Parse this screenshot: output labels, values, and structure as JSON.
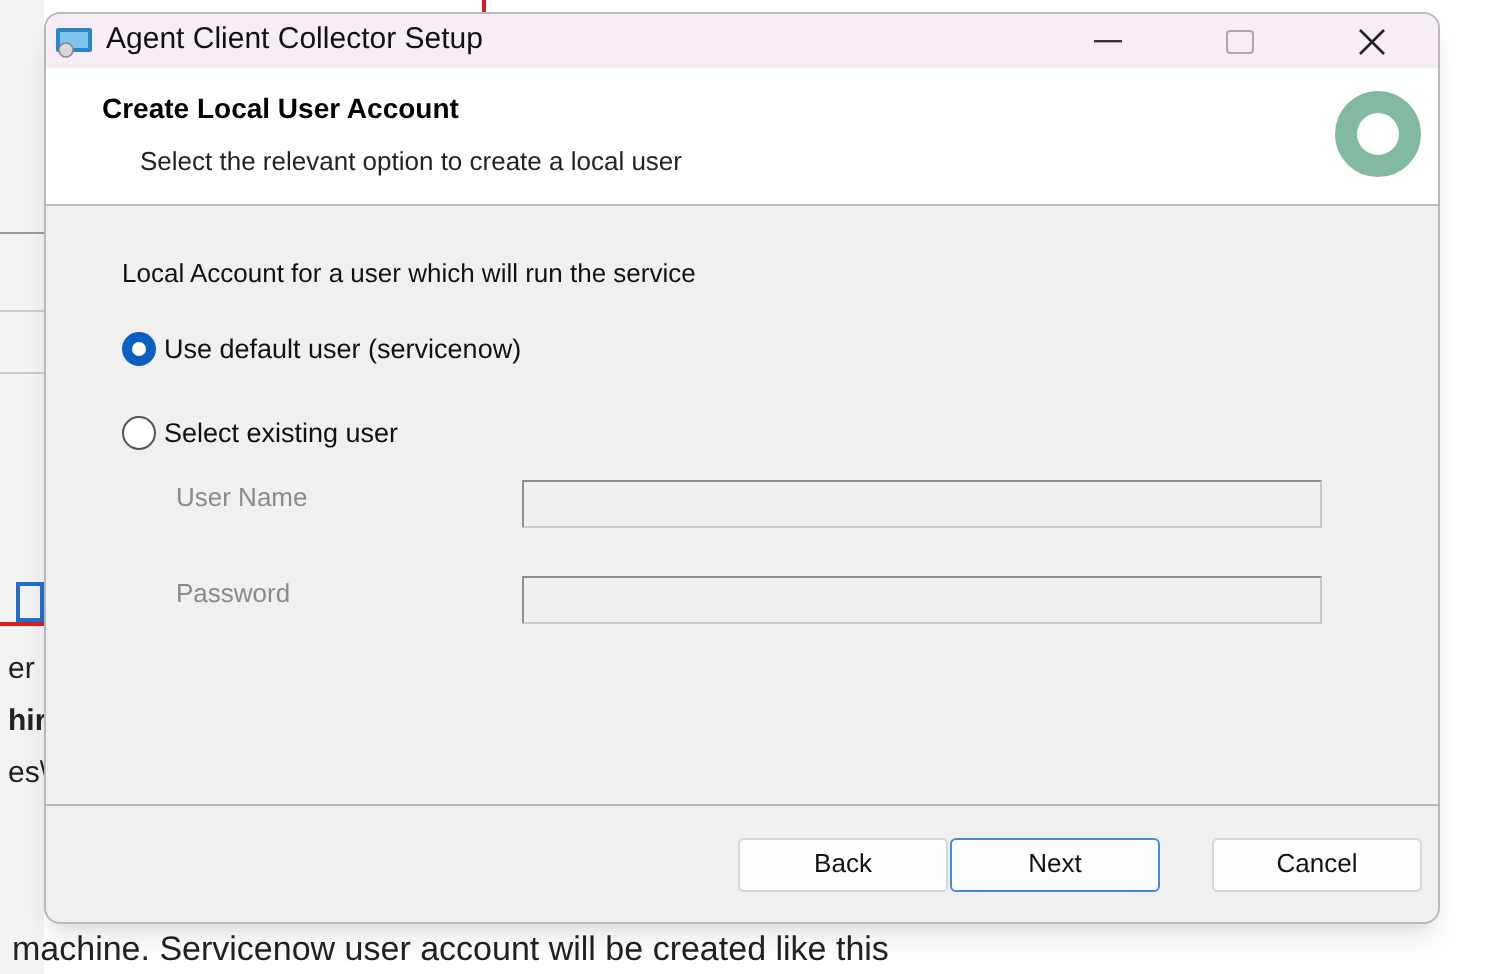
{
  "background_document": {
    "fragments": [
      {
        "text": "er",
        "bold": false
      },
      {
        "text": "hir",
        "bold": true
      },
      {
        "text": "es\\",
        "bold": false
      }
    ],
    "caption": "machine. Servicenow user account will be created like this"
  },
  "window": {
    "title": "Agent Client Collector Setup"
  },
  "header": {
    "title": "Create Local User Account",
    "subtitle": "Select the relevant option to create a local user"
  },
  "body": {
    "prompt": "Local Account for a user which will run the service",
    "options": [
      {
        "label": "Use default user (servicenow)",
        "selected": true
      },
      {
        "label": "Select existing user",
        "selected": false
      }
    ],
    "fields": [
      {
        "label": "User Name",
        "disabled": true
      },
      {
        "label": "Password",
        "disabled": true
      }
    ]
  },
  "buttons": [
    {
      "label": "Back",
      "focused": false
    },
    {
      "label": "Next",
      "focused": true
    },
    {
      "label": "Cancel",
      "focused": false
    }
  ]
}
